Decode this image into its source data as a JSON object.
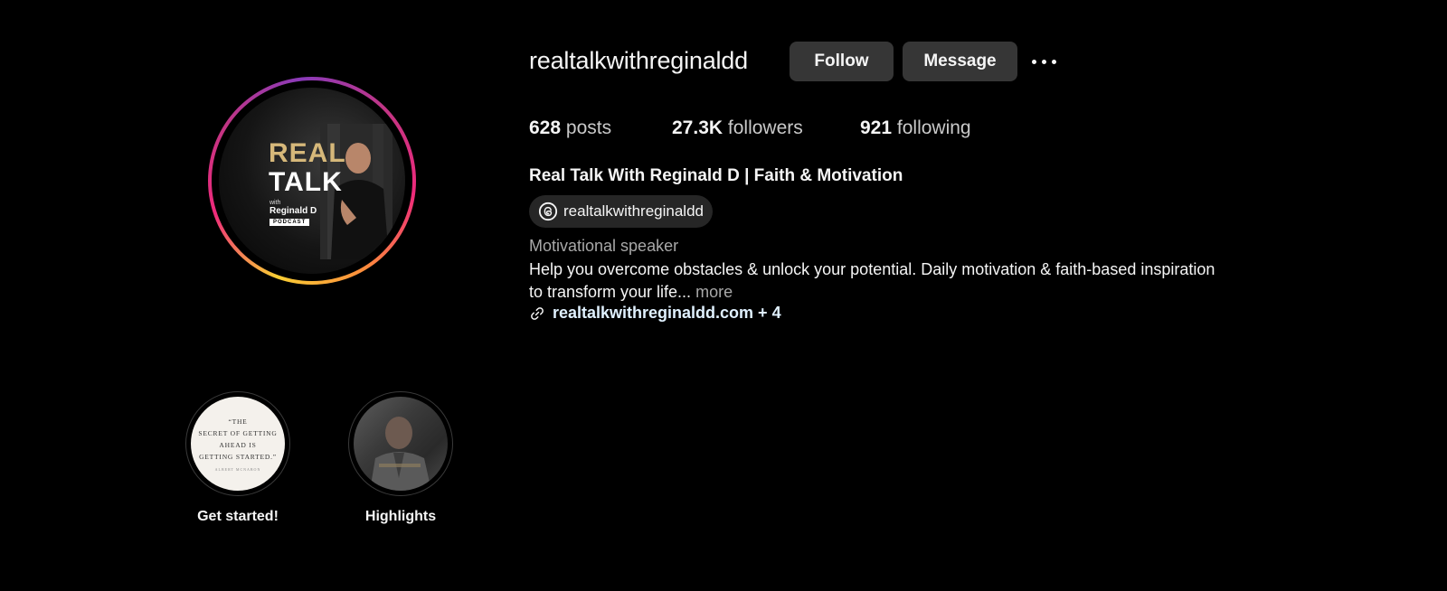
{
  "profile": {
    "username": "realtalkwithreginaldd",
    "follow_label": "Follow",
    "message_label": "Message",
    "more_icon": "ellipsis-icon"
  },
  "avatar": {
    "title_line1": "REAL",
    "title_line2": "TALK",
    "with": "with",
    "name": "Reginald D",
    "badge": "PODCAST",
    "ring_colors": [
      "#f9ce34",
      "#ee2a7b",
      "#8a3ab9"
    ]
  },
  "stats": {
    "posts_value": "628",
    "posts_label": "posts",
    "followers_value": "27.3K",
    "followers_label": "followers",
    "following_value": "921",
    "following_label": "following"
  },
  "bio": {
    "full_name": "Real Talk With Reginald D | Faith & Motivation",
    "threads_handle": "realtalkwithreginaldd",
    "category": "Motivational speaker",
    "text": "Help you overcome obstacles & unlock your potential. Daily motivation & faith-based inspiration to transform your life...",
    "more_label": "more",
    "link_text": "realtalkwithreginaldd.com + 4"
  },
  "highlights": [
    {
      "label": "Get started!",
      "quote_line1": "“THE",
      "quote_line2": "SECRET OF GETTING",
      "quote_line3": "AHEAD IS",
      "quote_line4": "GETTING STARTED.”",
      "quote_author": "ALBERT MCNABON"
    },
    {
      "label": "Highlights"
    }
  ]
}
